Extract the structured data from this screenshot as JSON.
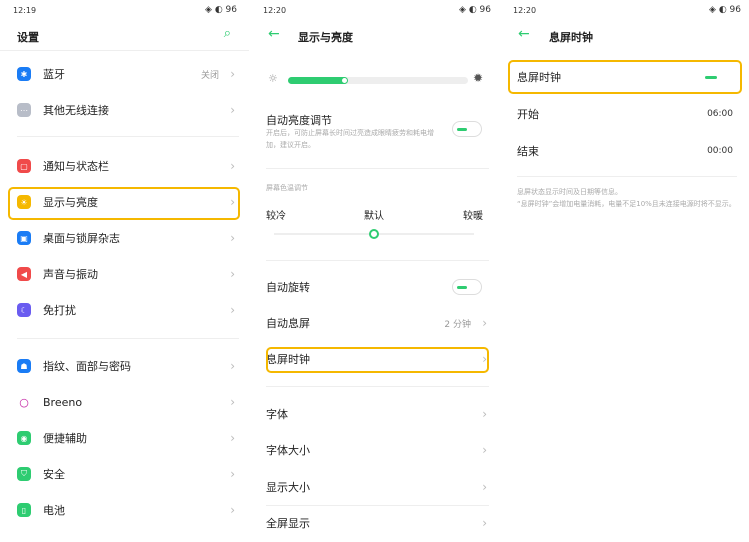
{
  "panel1": {
    "status_time": "12:19",
    "status_icons": "◈ ◐ 96",
    "title": "设置",
    "items": [
      {
        "label": "蓝牙",
        "value": "关闭",
        "color": "#1a7cf5",
        "icon": "bluetooth-icon",
        "glyph": "✱"
      },
      {
        "label": "其他无线连接",
        "color": "#b8bdc8",
        "icon": "wireless-icon",
        "glyph": "⋯"
      },
      {
        "label": "通知与状态栏",
        "color": "#f04a4a",
        "icon": "notification-icon",
        "glyph": "▢"
      },
      {
        "label": "显示与亮度",
        "color": "#f5b800",
        "icon": "brightness-icon",
        "glyph": "☀"
      },
      {
        "label": "桌面与锁屏杂志",
        "color": "#1a7cf5",
        "icon": "wallpaper-icon",
        "glyph": "▣"
      },
      {
        "label": "声音与振动",
        "color": "#f04a4a",
        "icon": "sound-icon",
        "glyph": "◀"
      },
      {
        "label": "免打扰",
        "color": "#6a5cf0",
        "icon": "moon-icon",
        "glyph": "☾"
      },
      {
        "label": "指纹、面部与密码",
        "color": "#1a7cf5",
        "icon": "fingerprint-icon",
        "glyph": "☗"
      },
      {
        "label": "Breeno",
        "color": "#c0179e",
        "icon": "breeno-icon",
        "glyph": "○"
      },
      {
        "label": "便捷辅助",
        "color": "#2ecc71",
        "icon": "assist-icon",
        "glyph": "◉"
      },
      {
        "label": "安全",
        "color": "#2ecc71",
        "icon": "shield-icon",
        "glyph": "⛉"
      },
      {
        "label": "电池",
        "color": "#2ecc71",
        "icon": "battery-icon",
        "glyph": "▯"
      }
    ]
  },
  "panel2": {
    "status_time": "12:20",
    "status_icons": "◈ ◐ 96",
    "title": "显示与亮度",
    "brightness_level": 0.33,
    "auto_brightness": {
      "label": "自动亮度调节",
      "desc": "开启后，可防止屏幕长时间过亮造成眼睛疲劳和耗电增加，建议开启。"
    },
    "color_temp": {
      "section": "屏幕色温调节",
      "cold": "较冷",
      "default": "默认",
      "warm": "较暖",
      "level": 0.5
    },
    "auto_rotate": "自动旋转",
    "auto_sleep": {
      "label": "自动息屏",
      "value": "2 分钟"
    },
    "aod_clock": "息屏时钟",
    "font": "字体",
    "font_size": "字体大小",
    "display_size": "显示大小",
    "fullscreen": "全屏显示"
  },
  "panel3": {
    "status_time": "12:20",
    "status_icons": "◈ ◐ 96",
    "title": "息屏时钟",
    "toggle_label": "息屏时钟",
    "start_label": "开始",
    "start_value": "06:00",
    "end_label": "结束",
    "end_value": "00:00",
    "desc1": "息屏状态显示时间及日期等信息。",
    "desc2": "“息屏时钟”会增加电量消耗，电量不足10%且未连接电源时将不显示。"
  }
}
